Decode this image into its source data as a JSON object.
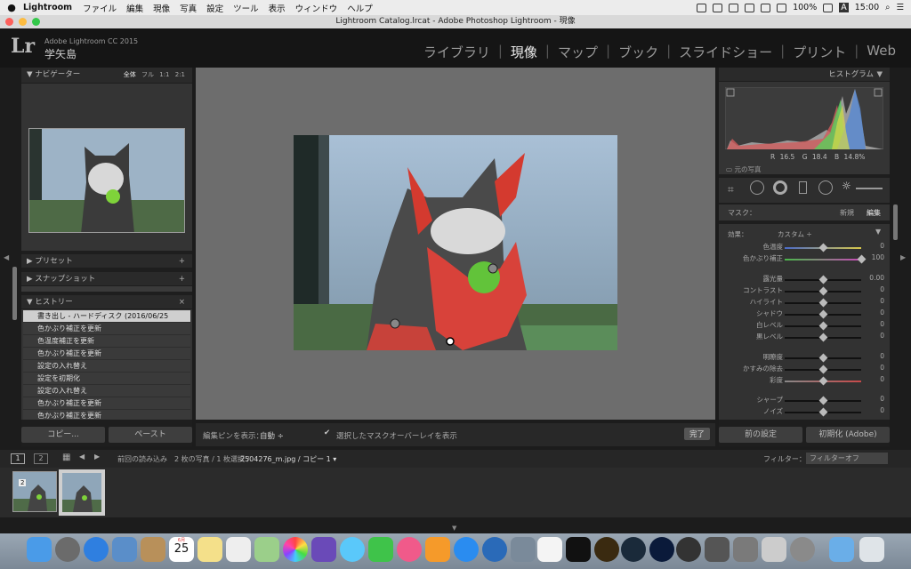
{
  "menubar": {
    "app": "Lightroom",
    "items": [
      "ファイル",
      "編集",
      "現像",
      "写真",
      "設定",
      "ツール",
      "表示",
      "ウィンドウ",
      "ヘルプ"
    ],
    "battery": "100%",
    "input": "A",
    "clock": "15:00"
  },
  "window_title": "Lightroom Catalog.lrcat - Adobe Photoshop Lightroom - 現像",
  "identity": {
    "logo": "Lr",
    "version": "Adobe Lightroom CC 2015",
    "user": "学矢島"
  },
  "modules": [
    "ライブラリ",
    "現像",
    "マップ",
    "ブック",
    "スライドショー",
    "プリント",
    "Web"
  ],
  "active_module": "現像",
  "navigator": {
    "title": "ナビゲーター",
    "zooms": [
      "全体",
      "フル",
      "1:1",
      "2:1"
    ]
  },
  "presets": "プリセット",
  "snapshots": "スナップショット",
  "history": {
    "title": "ヒストリー",
    "items": [
      "書き出し - ハードディスク (2016/06/25 14:55:09)",
      "色かぶり補正を更新",
      "色温度補正を更新",
      "色かぶり補正を更新",
      "設定の入れ替え",
      "設定を初期化",
      "設定の入れ替え",
      "色かぶり補正を更新",
      "色かぶり補正を更新"
    ]
  },
  "left_buttons": {
    "copy": "コピー...",
    "paste": "ペースト"
  },
  "toolbar": {
    "pin_label": "編集ピンを表示：",
    "pin_value": "自動 ÷",
    "overlay_label": "選択したマスクオーバーレイを表示",
    "done": "完了"
  },
  "histogram": {
    "title": "ヒストグラム",
    "r_label": "R",
    "r": "16.5",
    "g_label": "G",
    "g": "18.4",
    "b_label": "B",
    "b": "14.8%",
    "original": "元の写真"
  },
  "mask": {
    "label": "マスク：",
    "new": "新規",
    "edit": "編集"
  },
  "effect": {
    "label": "効果：",
    "value": "カスタム ÷"
  },
  "sliders": [
    {
      "label": "色温度",
      "value": "0",
      "pos": 0.5
    },
    {
      "label": "色かぶり補正",
      "value": "100",
      "pos": 1.0
    },
    {
      "label": "露光量",
      "value": "0.00",
      "pos": 0.5
    },
    {
      "label": "コントラスト",
      "value": "0",
      "pos": 0.5
    },
    {
      "label": "ハイライト",
      "value": "0",
      "pos": 0.5
    },
    {
      "label": "シャドウ",
      "value": "0",
      "pos": 0.5
    },
    {
      "label": "白レベル",
      "value": "0",
      "pos": 0.5
    },
    {
      "label": "黒レベル",
      "value": "0",
      "pos": 0.5
    },
    {
      "label": "明瞭度",
      "value": "0",
      "pos": 0.5
    },
    {
      "label": "かすみの除去",
      "value": "0",
      "pos": 0.5
    },
    {
      "label": "彩度",
      "value": "0",
      "pos": 0.5
    },
    {
      "label": "シャープ",
      "value": "0",
      "pos": 0.5
    },
    {
      "label": "ノイズ",
      "value": "0",
      "pos": 0.5
    }
  ],
  "right_buttons": {
    "prev": "前の設定",
    "reset": "初期化 (Adobe)"
  },
  "filmstrip": {
    "screen1": "1",
    "screen2": "2",
    "source": "前回の読み込み",
    "info": "2 枚の写真 / 1 枚選択 /",
    "file": "2504276_m.jpg / コピー 1 ▾",
    "filter_label": "フィルター：",
    "filter_value": "フィルターオフ",
    "badge": "2"
  },
  "dock": {
    "calendar_month": "6月",
    "calendar_day": "25"
  }
}
